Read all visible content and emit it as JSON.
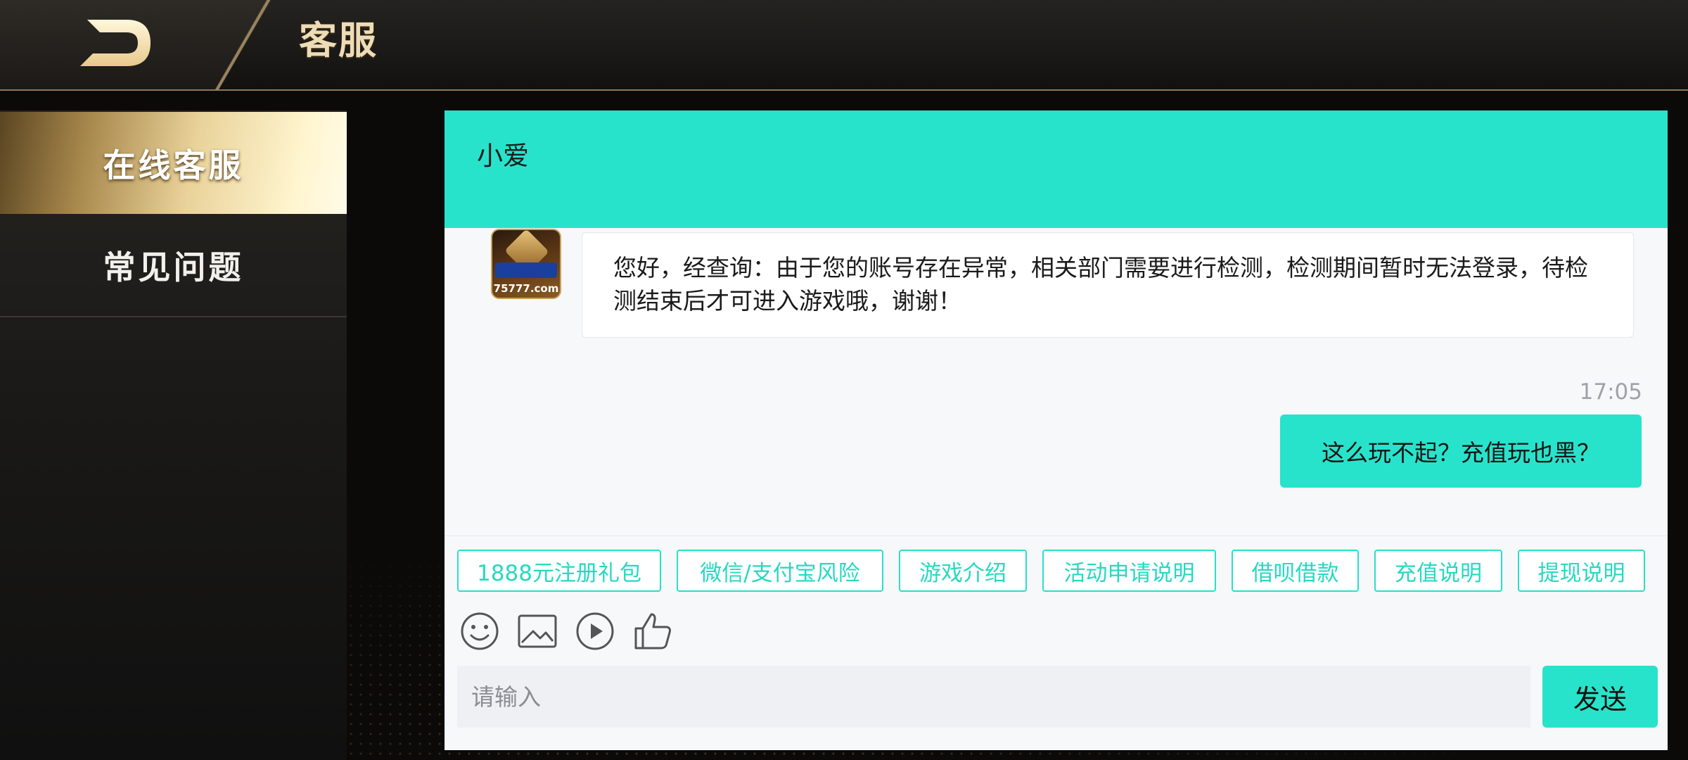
{
  "header": {
    "title": "客服",
    "back_icon": "back-arrow-icon"
  },
  "sidebar": {
    "items": [
      {
        "label": "在线客服",
        "active": true
      },
      {
        "label": "常见问题",
        "active": false
      }
    ]
  },
  "chat": {
    "agent_name": "小爱",
    "avatar": {
      "text": "75777.com",
      "icon": "app-logo-icon"
    },
    "messages": [
      {
        "from": "agent",
        "text": "您好，经查询：由于您的账号存在异常，相关部门需要进行检测，检测期间暂时无法登录，待检测结束后才可进入游戏哦，谢谢！"
      },
      {
        "from": "user",
        "time": "17:05",
        "text": "这么玩不起？充值玩也黑？"
      }
    ],
    "quick_replies": [
      "1888元注册礼包",
      "微信/支付宝风险",
      "游戏介绍",
      "活动申请说明",
      "借呗借款",
      "充值说明",
      "提现说明"
    ],
    "tools": [
      "emoji-icon",
      "image-icon",
      "video-icon",
      "thumbs-up-icon"
    ],
    "input": {
      "placeholder": "请输入",
      "value": ""
    },
    "send_label": "发送"
  },
  "colors": {
    "accent": "#28e3cb",
    "gold": "#efdcb6",
    "chip_text": "#26d9c1"
  }
}
